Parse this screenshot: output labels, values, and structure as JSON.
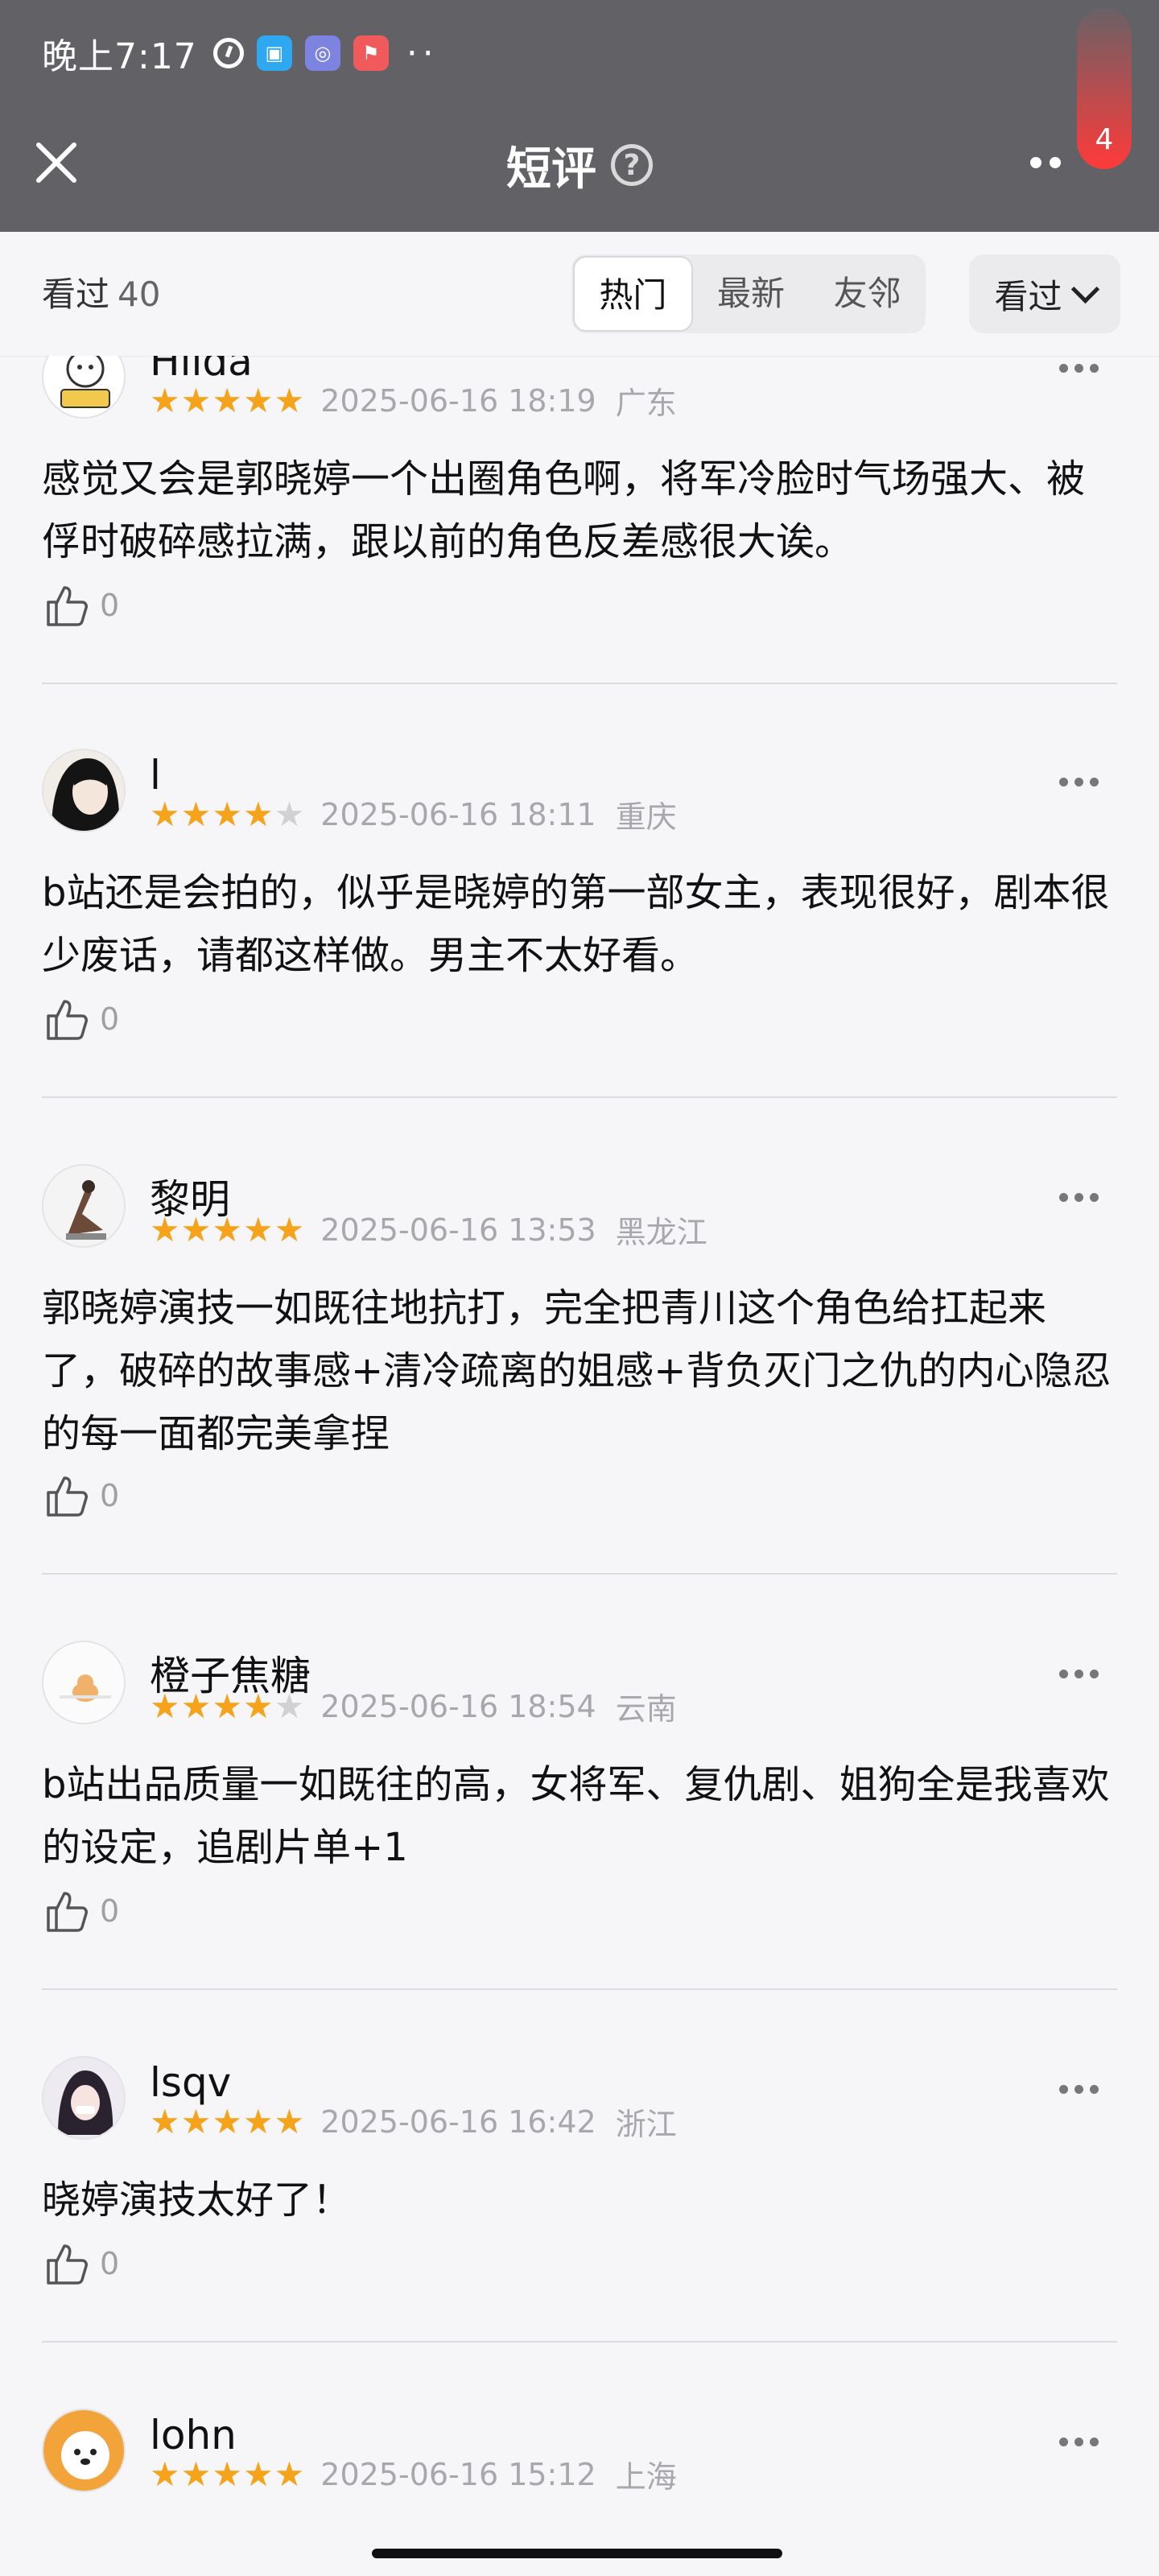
{
  "status_bar": {
    "time": "晚上7:17",
    "more": "··"
  },
  "header": {
    "title": "短评",
    "help_icon": "?",
    "badge_count": "4"
  },
  "filter": {
    "seen_label": "看过",
    "seen_count": "40",
    "tabs": [
      {
        "label": "热门",
        "active": true
      },
      {
        "label": "最新",
        "active": false
      },
      {
        "label": "友邻",
        "active": false
      }
    ],
    "dropdown_label": "看过"
  },
  "reviews": [
    {
      "name": "Hilda",
      "rating": 5,
      "datetime": "2025-06-16 18:19",
      "region": "广东",
      "content": "感觉又会是郭晓婷一个出圈角色啊，将军冷脸时气场强大、被俘时破碎感拉满，跟以前的角色反差感很大诶。",
      "likes": "0"
    },
    {
      "name": "l",
      "rating": 4,
      "datetime": "2025-06-16 18:11",
      "region": "重庆",
      "content": "b站还是会拍的，似乎是晓婷的第一部女主，表现很好，剧本很少废话，请都这样做。男主不太好看。",
      "likes": "0"
    },
    {
      "name": "黎明",
      "rating": 5,
      "datetime": "2025-06-16 13:53",
      "region": "黑龙江",
      "content": "郭晓婷演技一如既往地抗打，完全把青川这个角色给扛起来了，破碎的故事感+清冷疏离的姐感+背负灭门之仇的内心隐忍的每一面都完美拿捏",
      "likes": "0"
    },
    {
      "name": "橙子焦糖",
      "rating": 4,
      "datetime": "2025-06-16 18:54",
      "region": "云南",
      "content": "b站出品质量一如既往的高，女将军、复仇剧、姐狗全是我喜欢的设定，追剧片单+1",
      "likes": "0"
    },
    {
      "name": "lsqv",
      "rating": 5,
      "datetime": "2025-06-16 16:42",
      "region": "浙江",
      "content": "晓婷演技太好了！",
      "likes": "0"
    },
    {
      "name": "lohn",
      "rating": 5,
      "datetime": "2025-06-16 15:12",
      "region": "上海",
      "content": "",
      "likes": ""
    }
  ]
}
